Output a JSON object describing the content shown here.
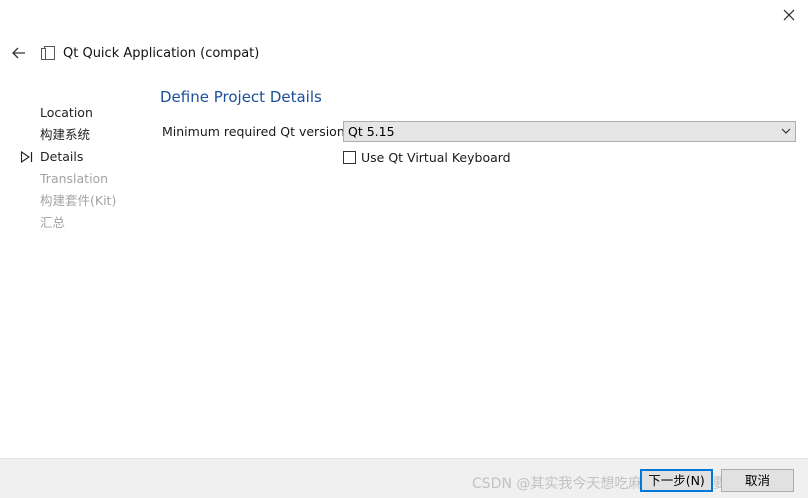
{
  "window": {
    "title": "Qt Quick Application (compat)"
  },
  "wizard": {
    "steps": [
      {
        "label": "Location",
        "state": "done"
      },
      {
        "label": "构建系统",
        "state": "done"
      },
      {
        "label": "Details",
        "state": "current"
      },
      {
        "label": "Translation",
        "state": "disabled"
      },
      {
        "label": "构建套件(Kit)",
        "state": "disabled"
      },
      {
        "label": "汇总",
        "state": "disabled"
      }
    ],
    "page_title": "Define Project Details"
  },
  "form": {
    "min_qt_label": "Minimum required Qt version:",
    "min_qt_value": "Qt 5.15",
    "virtual_keyboard_label": "Use Qt Virtual Keyboard",
    "virtual_keyboard_checked": false
  },
  "footer": {
    "watermark": "CSDN @其实我今天想吃麻辣烫微辣不要面",
    "next_label": "下一步(N)",
    "cancel_label": "取消"
  },
  "colors": {
    "title_blue": "#1b4f9c",
    "focus_blue": "#0078d7",
    "disabled_gray": "#a3a3a3"
  },
  "icons": {
    "close": "close-icon",
    "back": "back-arrow-icon",
    "wizard": "document-icon",
    "current_step": "current-step-marker-icon",
    "combo_arrow": "chevron-down-icon"
  }
}
